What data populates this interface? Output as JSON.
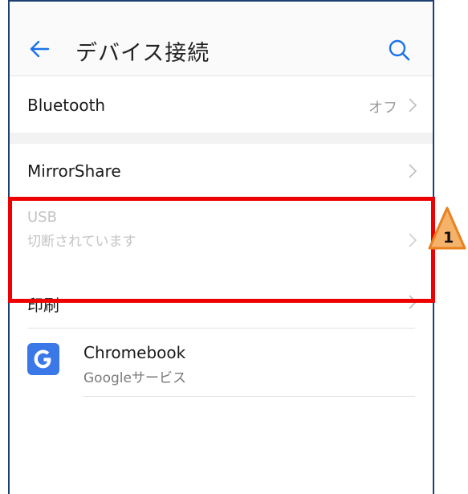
{
  "header": {
    "title": "デバイス接続",
    "back_icon": "back-arrow-icon",
    "search_icon": "search-icon"
  },
  "items": {
    "bluetooth": {
      "label": "Bluetooth",
      "value": "オフ"
    },
    "mirrorshare": {
      "label": "MirrorShare"
    },
    "usb": {
      "label": "USB",
      "status": "切断されています"
    },
    "print": {
      "label": "印刷"
    },
    "chromebook": {
      "label": "Chromebook",
      "sub": "Googleサービス"
    }
  },
  "annotation": {
    "number": "1"
  },
  "colors": {
    "accent": "#1a73e8",
    "highlight": "#ee0000",
    "callout_fill": "#f5b26b",
    "callout_stroke": "#e8821f",
    "google_icon": "#3b78e7"
  }
}
